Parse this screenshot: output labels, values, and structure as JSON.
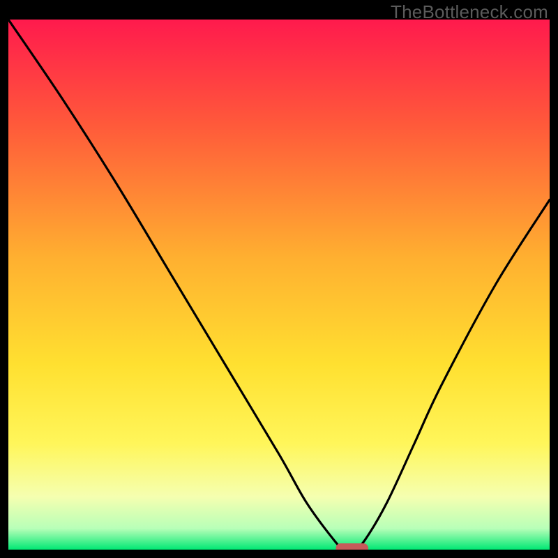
{
  "watermark": "TheBottleneck.com",
  "chart_data": {
    "type": "line",
    "title": "",
    "xlabel": "",
    "ylabel": "",
    "xlim": [
      0,
      100
    ],
    "ylim": [
      0,
      100
    ],
    "series": [
      {
        "name": "bottleneck-curve",
        "x": [
          0,
          10,
          20,
          30,
          40,
          50,
          55,
          60,
          62,
          64,
          66,
          70,
          75,
          80,
          90,
          100
        ],
        "values": [
          100,
          85,
          69,
          52,
          35,
          18,
          9,
          2,
          0,
          0,
          2,
          9,
          20,
          31,
          50,
          66
        ]
      }
    ],
    "marker": {
      "name": "optimal-range",
      "x_start": 60.5,
      "x_end": 66.5,
      "y": 0
    },
    "background_gradient_stops": [
      {
        "offset": 0.0,
        "color": "#ff1a4d"
      },
      {
        "offset": 0.2,
        "color": "#ff5a3a"
      },
      {
        "offset": 0.45,
        "color": "#ffb030"
      },
      {
        "offset": 0.65,
        "color": "#ffe030"
      },
      {
        "offset": 0.8,
        "color": "#fff65a"
      },
      {
        "offset": 0.9,
        "color": "#f5ffb0"
      },
      {
        "offset": 0.96,
        "color": "#b8ffb8"
      },
      {
        "offset": 1.0,
        "color": "#00e874"
      }
    ],
    "marker_color": "#c65a5a"
  }
}
